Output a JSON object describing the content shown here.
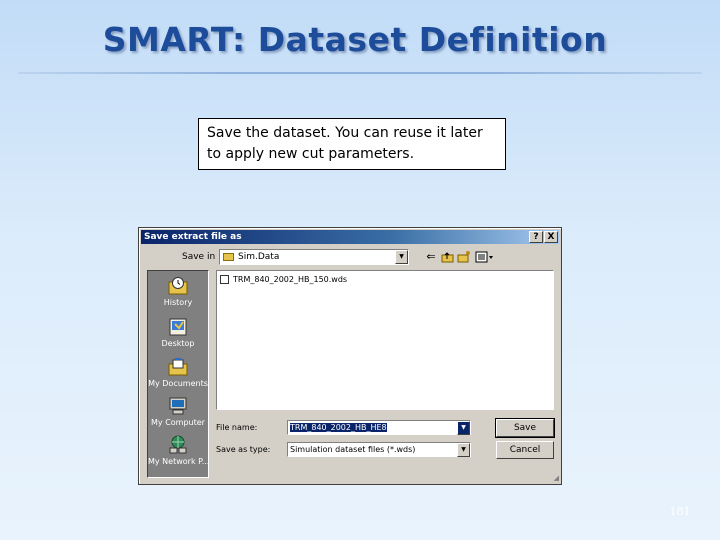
{
  "slide": {
    "title": "SMART: Dataset Definition",
    "callout": "Save the dataset. You can reuse it later to apply new cut parameters.",
    "page_number": "181"
  },
  "dialog": {
    "title": "Save extract file as",
    "help_icon": "?",
    "close_icon": "X",
    "save_in_label": "Save in",
    "save_in_value": "Sim.Data",
    "toolbar_icons": [
      "back-arrow-icon",
      "up-folder-icon",
      "new-folder-icon",
      "view-menu-icon"
    ],
    "places": [
      {
        "label": "History",
        "icon": "history-icon"
      },
      {
        "label": "Desktop",
        "icon": "desktop-icon"
      },
      {
        "label": "My Documents",
        "icon": "my-documents-icon"
      },
      {
        "label": "My Computer",
        "icon": "my-computer-icon"
      },
      {
        "label": "My Network P...",
        "icon": "my-network-icon"
      }
    ],
    "files": [
      "TRM_840_2002_HB_150.wds"
    ],
    "file_name_label": "File name:",
    "file_name_value": "TRM_840_2002_HB_HE8",
    "save_as_type_label": "Save as type:",
    "save_as_type_value": "Simulation dataset files (*.wds)",
    "save_button": "Save",
    "cancel_button": "Cancel"
  },
  "colors": {
    "title": "#1d4c9a",
    "titlebar": "#0a246a",
    "dialog_face": "#d4d0c8"
  }
}
